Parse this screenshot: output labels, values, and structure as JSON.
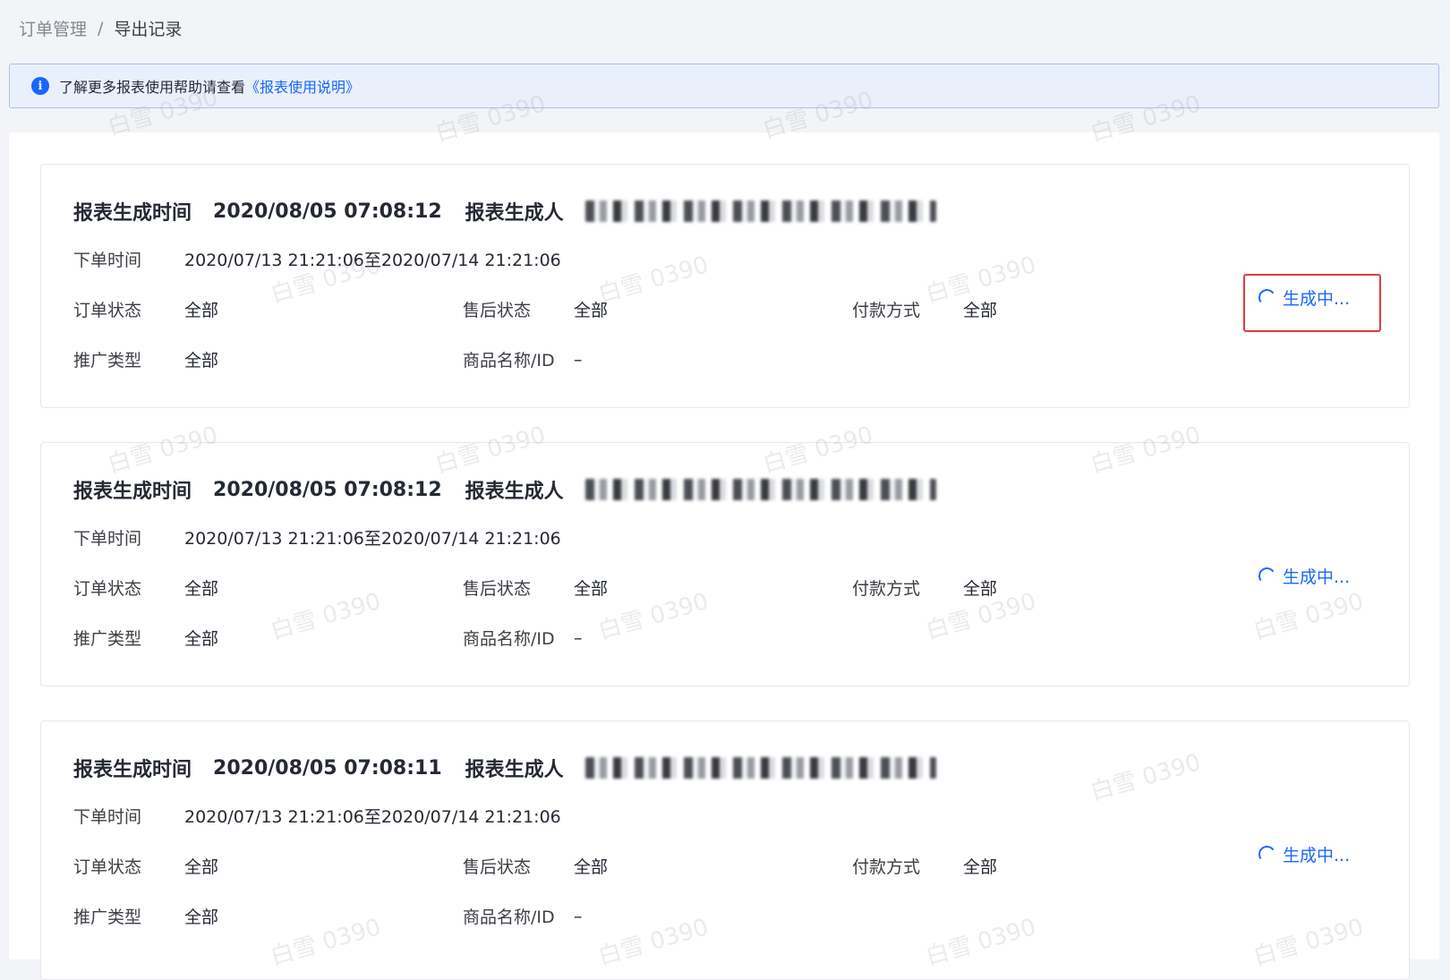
{
  "breadcrumb": {
    "parent": "订单管理",
    "separator": "/",
    "current": "导出记录"
  },
  "notice": {
    "icon": "info-icon",
    "text": "了解更多报表使用帮助请查看",
    "link": "《报表使用说明》"
  },
  "labels": {
    "report_time": "报表生成时间",
    "report_creator": "报表生成人",
    "order_time": "下单时间",
    "order_status": "订单状态",
    "aftersale_status": "售后状态",
    "payment_method": "付款方式",
    "promotion_type": "推广类型",
    "product_name_id": "商品名称/ID"
  },
  "records": [
    {
      "report_time": "2020/08/05 07:08:12",
      "order_time": "2020/07/13 21:21:06至2020/07/14 21:21:06",
      "order_status": "全部",
      "aftersale_status": "全部",
      "payment_method": "全部",
      "promotion_type": "全部",
      "product_name_id": "–",
      "status": "生成中..."
    },
    {
      "report_time": "2020/08/05 07:08:12",
      "order_time": "2020/07/13 21:21:06至2020/07/14 21:21:06",
      "order_status": "全部",
      "aftersale_status": "全部",
      "payment_method": "全部",
      "promotion_type": "全部",
      "product_name_id": "–",
      "status": "生成中..."
    },
    {
      "report_time": "2020/08/05 07:08:11",
      "order_time": "2020/07/13 21:21:06至2020/07/14 21:21:06",
      "order_status": "全部",
      "aftersale_status": "全部",
      "payment_method": "全部",
      "promotion_type": "全部",
      "product_name_id": "–",
      "status": "生成中..."
    }
  ],
  "watermark": "白雪 0390",
  "colors": {
    "accent": "#1966ff",
    "highlight": "#e33b3b"
  }
}
